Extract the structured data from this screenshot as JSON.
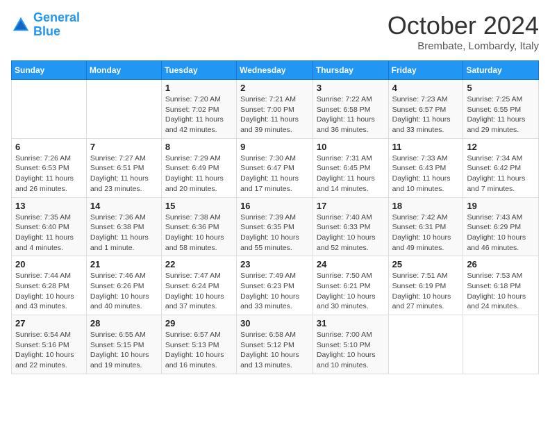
{
  "header": {
    "logo_line1": "General",
    "logo_line2": "Blue",
    "month_title": "October 2024",
    "subtitle": "Brembate, Lombardy, Italy"
  },
  "days_of_week": [
    "Sunday",
    "Monday",
    "Tuesday",
    "Wednesday",
    "Thursday",
    "Friday",
    "Saturday"
  ],
  "weeks": [
    [
      {
        "day": "",
        "info": ""
      },
      {
        "day": "",
        "info": ""
      },
      {
        "day": "1",
        "info": "Sunrise: 7:20 AM\nSunset: 7:02 PM\nDaylight: 11 hours and 42 minutes."
      },
      {
        "day": "2",
        "info": "Sunrise: 7:21 AM\nSunset: 7:00 PM\nDaylight: 11 hours and 39 minutes."
      },
      {
        "day": "3",
        "info": "Sunrise: 7:22 AM\nSunset: 6:58 PM\nDaylight: 11 hours and 36 minutes."
      },
      {
        "day": "4",
        "info": "Sunrise: 7:23 AM\nSunset: 6:57 PM\nDaylight: 11 hours and 33 minutes."
      },
      {
        "day": "5",
        "info": "Sunrise: 7:25 AM\nSunset: 6:55 PM\nDaylight: 11 hours and 29 minutes."
      }
    ],
    [
      {
        "day": "6",
        "info": "Sunrise: 7:26 AM\nSunset: 6:53 PM\nDaylight: 11 hours and 26 minutes."
      },
      {
        "day": "7",
        "info": "Sunrise: 7:27 AM\nSunset: 6:51 PM\nDaylight: 11 hours and 23 minutes."
      },
      {
        "day": "8",
        "info": "Sunrise: 7:29 AM\nSunset: 6:49 PM\nDaylight: 11 hours and 20 minutes."
      },
      {
        "day": "9",
        "info": "Sunrise: 7:30 AM\nSunset: 6:47 PM\nDaylight: 11 hours and 17 minutes."
      },
      {
        "day": "10",
        "info": "Sunrise: 7:31 AM\nSunset: 6:45 PM\nDaylight: 11 hours and 14 minutes."
      },
      {
        "day": "11",
        "info": "Sunrise: 7:33 AM\nSunset: 6:43 PM\nDaylight: 11 hours and 10 minutes."
      },
      {
        "day": "12",
        "info": "Sunrise: 7:34 AM\nSunset: 6:42 PM\nDaylight: 11 hours and 7 minutes."
      }
    ],
    [
      {
        "day": "13",
        "info": "Sunrise: 7:35 AM\nSunset: 6:40 PM\nDaylight: 11 hours and 4 minutes."
      },
      {
        "day": "14",
        "info": "Sunrise: 7:36 AM\nSunset: 6:38 PM\nDaylight: 11 hours and 1 minute."
      },
      {
        "day": "15",
        "info": "Sunrise: 7:38 AM\nSunset: 6:36 PM\nDaylight: 10 hours and 58 minutes."
      },
      {
        "day": "16",
        "info": "Sunrise: 7:39 AM\nSunset: 6:35 PM\nDaylight: 10 hours and 55 minutes."
      },
      {
        "day": "17",
        "info": "Sunrise: 7:40 AM\nSunset: 6:33 PM\nDaylight: 10 hours and 52 minutes."
      },
      {
        "day": "18",
        "info": "Sunrise: 7:42 AM\nSunset: 6:31 PM\nDaylight: 10 hours and 49 minutes."
      },
      {
        "day": "19",
        "info": "Sunrise: 7:43 AM\nSunset: 6:29 PM\nDaylight: 10 hours and 46 minutes."
      }
    ],
    [
      {
        "day": "20",
        "info": "Sunrise: 7:44 AM\nSunset: 6:28 PM\nDaylight: 10 hours and 43 minutes."
      },
      {
        "day": "21",
        "info": "Sunrise: 7:46 AM\nSunset: 6:26 PM\nDaylight: 10 hours and 40 minutes."
      },
      {
        "day": "22",
        "info": "Sunrise: 7:47 AM\nSunset: 6:24 PM\nDaylight: 10 hours and 37 minutes."
      },
      {
        "day": "23",
        "info": "Sunrise: 7:49 AM\nSunset: 6:23 PM\nDaylight: 10 hours and 33 minutes."
      },
      {
        "day": "24",
        "info": "Sunrise: 7:50 AM\nSunset: 6:21 PM\nDaylight: 10 hours and 30 minutes."
      },
      {
        "day": "25",
        "info": "Sunrise: 7:51 AM\nSunset: 6:19 PM\nDaylight: 10 hours and 27 minutes."
      },
      {
        "day": "26",
        "info": "Sunrise: 7:53 AM\nSunset: 6:18 PM\nDaylight: 10 hours and 24 minutes."
      }
    ],
    [
      {
        "day": "27",
        "info": "Sunrise: 6:54 AM\nSunset: 5:16 PM\nDaylight: 10 hours and 22 minutes."
      },
      {
        "day": "28",
        "info": "Sunrise: 6:55 AM\nSunset: 5:15 PM\nDaylight: 10 hours and 19 minutes."
      },
      {
        "day": "29",
        "info": "Sunrise: 6:57 AM\nSunset: 5:13 PM\nDaylight: 10 hours and 16 minutes."
      },
      {
        "day": "30",
        "info": "Sunrise: 6:58 AM\nSunset: 5:12 PM\nDaylight: 10 hours and 13 minutes."
      },
      {
        "day": "31",
        "info": "Sunrise: 7:00 AM\nSunset: 5:10 PM\nDaylight: 10 hours and 10 minutes."
      },
      {
        "day": "",
        "info": ""
      },
      {
        "day": "",
        "info": ""
      }
    ]
  ]
}
